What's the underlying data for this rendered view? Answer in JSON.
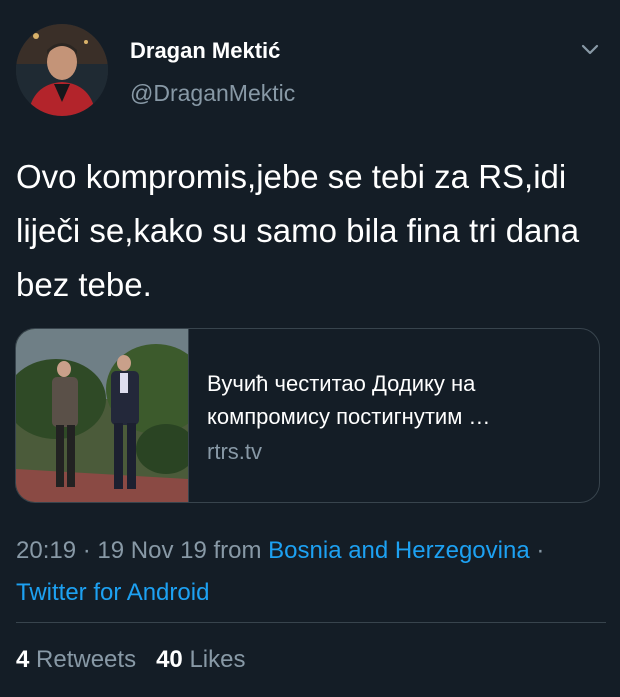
{
  "tweet": {
    "author_name": "Dragan Mektić",
    "author_handle": "@DraganMektic",
    "text": "Ovo kompromis,jebe se tebi za RS,idi liječi se,kako su samo bila fina tri dana bez tebe.",
    "card": {
      "title": "Вучић честитао Додику на компромису постигнутим …",
      "domain": "rtrs.tv"
    },
    "meta": {
      "time": "20:19",
      "date": "19 Nov 19",
      "from_label": "from",
      "location": "Bosnia and Herzegovina",
      "source": "Twitter for Android"
    },
    "stats": {
      "retweets_count": "4",
      "retweets_label": "Retweets",
      "likes_count": "40",
      "likes_label": "Likes"
    }
  },
  "icons": {
    "more": "chevron-down-icon"
  },
  "colors": {
    "background": "#141d26",
    "text": "#ffffff",
    "secondary": "#8899a6",
    "link": "#1da1f2",
    "border": "#38444d"
  }
}
